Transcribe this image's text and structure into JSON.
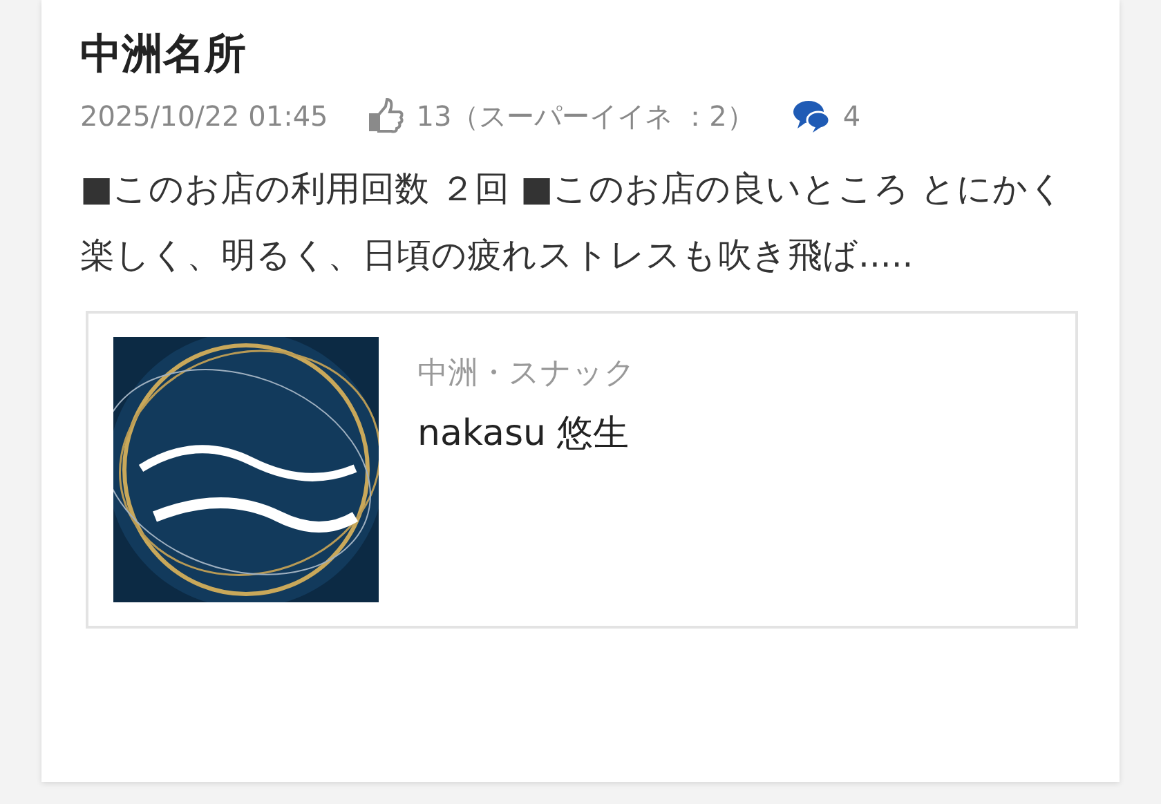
{
  "post": {
    "title": "中洲名所",
    "date": "2025/10/22 01:45",
    "likes": "13（スーパーイイネ ：2）",
    "comments": "4",
    "body": "■このお店の利用回数 ２回 ■このお店の良いところ とにかく楽しく、明るく、日頃の疲れストレスも吹き飛ば.....",
    "shop": {
      "category": "中洲・スナック",
      "name": "nakasu 悠生"
    }
  }
}
